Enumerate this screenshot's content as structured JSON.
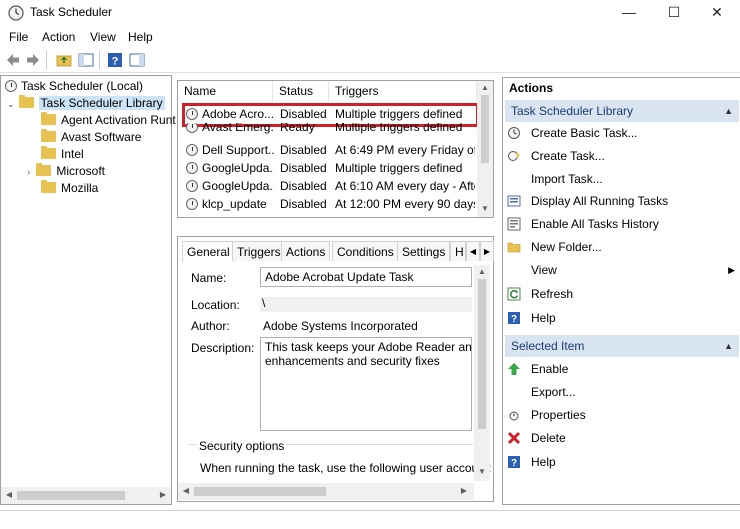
{
  "window": {
    "title": "Task Scheduler",
    "minimize": "—",
    "maximize": "☐",
    "close": "✕"
  },
  "menu": [
    "File",
    "Action",
    "View",
    "Help"
  ],
  "tree": {
    "root": "Task Scheduler (Local)",
    "library": "Task Scheduler Library",
    "folders": [
      "Agent Activation Runt",
      "Avast Software",
      "Intel",
      "Microsoft",
      "Mozilla"
    ]
  },
  "task_list": {
    "columns": [
      "Name",
      "Status",
      "Triggers"
    ],
    "rows": [
      {
        "name": "Adobe Acro...",
        "status": "Disabled",
        "triggers": "Multiple triggers defined"
      },
      {
        "name": "Avast Emerg...",
        "status": "Ready",
        "triggers": "Multiple triggers defined"
      },
      {
        "name": "Dell Support...",
        "status": "Disabled",
        "triggers": "At 6:49 PM every Friday of ev"
      },
      {
        "name": "GoogleUpda...",
        "status": "Disabled",
        "triggers": "Multiple triggers defined"
      },
      {
        "name": "GoogleUpda...",
        "status": "Disabled",
        "triggers": "At 6:10 AM every day - After"
      },
      {
        "name": "klcp_update",
        "status": "Disabled",
        "triggers": "At 12:00 PM every 90 days - T"
      }
    ]
  },
  "details": {
    "tabs": [
      "General",
      "Triggers",
      "Actions",
      "Conditions",
      "Settings",
      "H"
    ],
    "name_label": "Name:",
    "name_value": "Adobe Acrobat Update Task",
    "location_label": "Location:",
    "location_value": "\\",
    "author_label": "Author:",
    "author_value": "Adobe Systems Incorporated",
    "description_label": "Description:",
    "description_line1": "This task keeps your Adobe Reader and Ac",
    "description_line2": "enhancements and security fixes",
    "security_options": "Security options",
    "security_text": "When running the task, use the following user account:"
  },
  "actions": {
    "header": "Actions",
    "section1": "Task Scheduler Library",
    "items1": [
      {
        "label": "Create Basic Task...",
        "icon": "create-basic-task-icon"
      },
      {
        "label": "Create Task...",
        "icon": "create-task-icon"
      },
      {
        "label": "Import Task...",
        "icon": ""
      },
      {
        "label": "Display All Running Tasks",
        "icon": "running-tasks-icon"
      },
      {
        "label": "Enable All Tasks History",
        "icon": "history-icon"
      },
      {
        "label": "New Folder...",
        "icon": "folder-icon"
      },
      {
        "label": "View",
        "icon": ""
      },
      {
        "label": "Refresh",
        "icon": "refresh-icon"
      },
      {
        "label": "Help",
        "icon": "help-icon"
      }
    ],
    "section2": "Selected Item",
    "items2": [
      {
        "label": "Enable",
        "icon": "enable-arrow-icon"
      },
      {
        "label": "Export...",
        "icon": ""
      },
      {
        "label": "Properties",
        "icon": "properties-icon"
      },
      {
        "label": "Delete",
        "icon": "delete-x-icon"
      },
      {
        "label": "Help",
        "icon": "help-icon"
      }
    ]
  },
  "colors": {
    "selection_outline": "#d0202a",
    "section_header_bg": "#d9e4f1",
    "folder": "#e8c250"
  }
}
